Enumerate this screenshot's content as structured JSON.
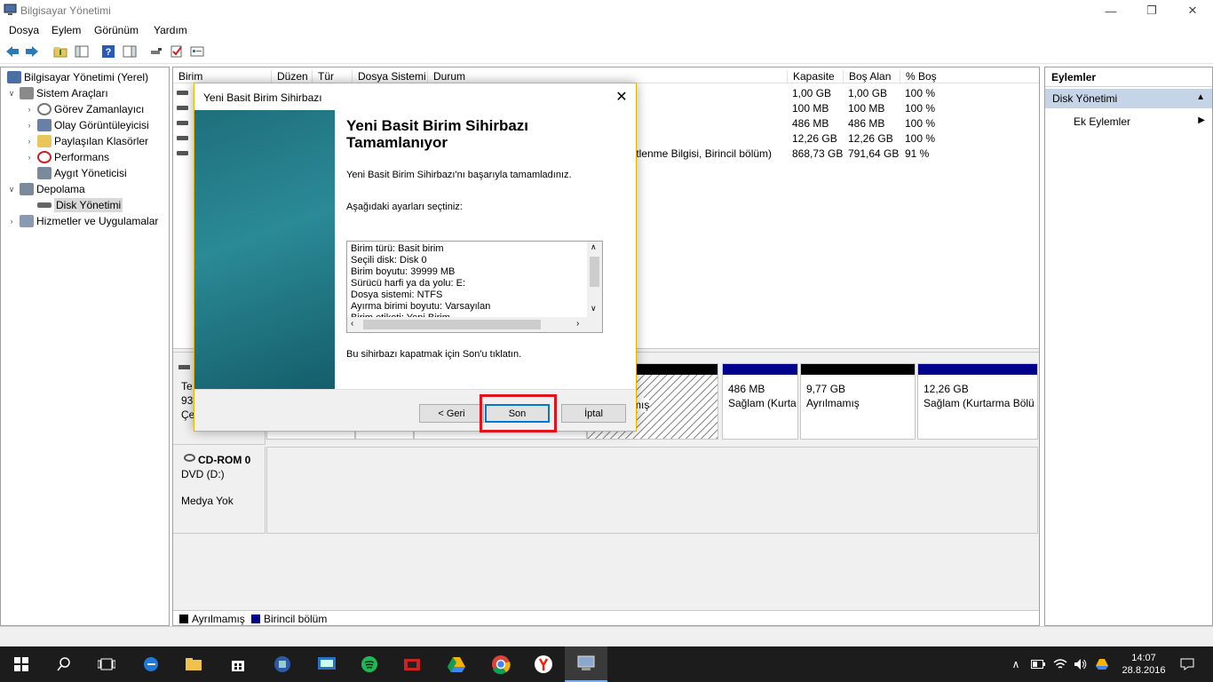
{
  "window": {
    "title": "Bilgisayar Yönetimi"
  },
  "menu": [
    "Dosya",
    "Eylem",
    "Görünüm",
    "Yardım"
  ],
  "tree": {
    "root": "Bilgisayar Yönetimi (Yerel)",
    "system_tools": "Sistem Araçları",
    "task_scheduler": "Görev Zamanlayıcı",
    "event_viewer": "Olay Görüntüleyicisi",
    "shared_folders": "Paylaşılan Klasörler",
    "performance": "Performans",
    "device_manager": "Aygıt Yöneticisi",
    "storage": "Depolama",
    "disk_management": "Disk Yönetimi",
    "services": "Hizmetler ve Uygulamalar"
  },
  "columns": {
    "volume": "Birim",
    "layout": "Düzen",
    "type": "Tür",
    "fs": "Dosya Sistemi",
    "status": "Durum",
    "capacity": "Kapasite",
    "free": "Boş Alan",
    "pct": "% Boş"
  },
  "volumes": [
    {
      "status": "",
      "capacity": "1,00 GB",
      "free": "1,00 GB",
      "pct": "100 %"
    },
    {
      "status": "",
      "capacity": "100 MB",
      "free": "100 MB",
      "pct": "100 %"
    },
    {
      "status": "",
      "capacity": "486 MB",
      "free": "486 MB",
      "pct": "100 %"
    },
    {
      "status": "",
      "capacity": "12,26 GB",
      "free": "12,26 GB",
      "pct": "100 %"
    },
    {
      "status": "iltlenme Bilgisi, Birincil bölüm)",
      "capacity": "868,73 GB",
      "free": "791,64 GB",
      "pct": "91 %"
    }
  ],
  "disk0": {
    "line1": "Te",
    "line2": "93",
    "line3": "Çe"
  },
  "partitions": {
    "p_unalloc_fragment": "mış",
    "p3_size": "486 MB",
    "p3_status": "Sağlam (Kurta",
    "p4_size": "9,77 GB",
    "p4_status": "Ayrılmamış",
    "p5_size": "12,26 GB",
    "p5_status": "Sağlam (Kurtarma Bölü"
  },
  "cdrom": {
    "name": "CD-ROM 0",
    "drive": "DVD (D:)",
    "media": "Medya Yok"
  },
  "legend": {
    "unallocated": "Ayrılmamış",
    "primary": "Birincil bölüm"
  },
  "actions": {
    "header": "Eylemler",
    "section": "Disk Yönetimi",
    "more": "Ek Eylemler"
  },
  "dialog": {
    "title": "Yeni Basit Birim Sihirbazı",
    "heading": "Yeni Basit Birim Sihirbazı Tamamlanıyor",
    "success": "Yeni Basit Birim Sihirbazı'nı başarıyla tamamladınız.",
    "selected_label": "Aşağıdaki ayarları seçtiniz:",
    "settings": [
      "Birim türü: Basit birim",
      "Seçili disk: Disk 0",
      "Birim boyutu: 39999 MB",
      "Sürücü harfi ya da yolu: E:",
      "Dosya sistemi: NTFS",
      "Ayırma birimi boyutu: Varsayılan",
      "Birim etiketi: Yeni Birim"
    ],
    "close_hint": "Bu sihirbazı kapatmak için Son'u tıklatın.",
    "back": "< Geri",
    "finish": "Son",
    "cancel": "İptal"
  },
  "clock": {
    "time": "14:07",
    "date": "28.8.2016"
  },
  "colors": {
    "primary_partition": "#00008b",
    "unallocated": "#000000",
    "highlight": "#e3131b",
    "selection": "#c5d4e6"
  }
}
